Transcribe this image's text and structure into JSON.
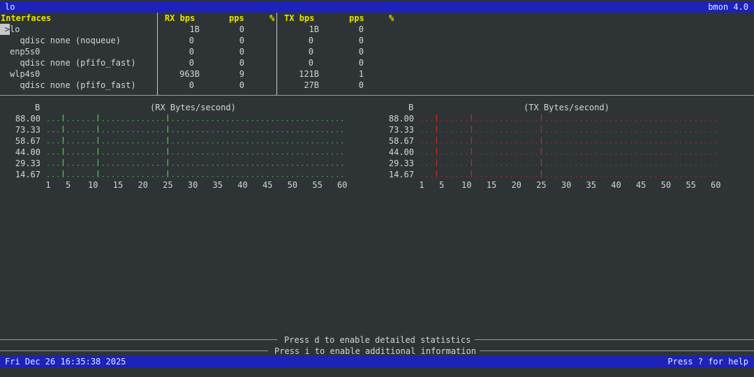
{
  "title_bar": {
    "iface": "lo",
    "app": "bmon 4.0"
  },
  "header": {
    "interfaces": "Interfaces",
    "rx_bps": "RX bps",
    "rx_pps": "pps",
    "rx_pct": "%",
    "tx_bps": "TX bps",
    "tx_pps": "pps",
    "tx_pct": "%"
  },
  "rows": [
    {
      "name": "lo",
      "cursor": ">",
      "rx_bps": "1B",
      "rx_pps": "0",
      "tx_bps": "1B",
      "tx_pps": "0"
    },
    {
      "name": "  qdisc none (noqueue)",
      "rx_bps": "0",
      "rx_pps": "0",
      "tx_bps": "0",
      "tx_pps": "0"
    },
    {
      "name": "enp5s0",
      "rx_bps": "0",
      "rx_pps": "0",
      "tx_bps": "0",
      "tx_pps": "0"
    },
    {
      "name": "  qdisc none (pfifo_fast)",
      "rx_bps": "0",
      "rx_pps": "0",
      "tx_bps": "0",
      "tx_pps": "0"
    },
    {
      "name": "wlp4s0",
      "rx_bps": "963B",
      "rx_pps": "9",
      "tx_bps": "121B",
      "tx_pps": "1"
    },
    {
      "name": "  qdisc none (pfifo_fast)",
      "rx_bps": "0",
      "rx_pps": "0",
      "tx_bps": "27B",
      "tx_pps": "0"
    }
  ],
  "graphs": {
    "rx": {
      "unit": "B",
      "title": "(RX Bytes/second)",
      "color": "#4cc34c"
    },
    "tx": {
      "unit": "B",
      "title": "(TX Bytes/second)",
      "color": "#cc2222"
    },
    "y_labels": [
      "88.00",
      "73.33",
      "58.67",
      "44.00",
      "29.33",
      "14.67"
    ],
    "x_labels": [
      "1",
      "5",
      "10",
      "15",
      "20",
      "25",
      "30",
      "35",
      "40",
      "45",
      "50",
      "55",
      "60"
    ],
    "bar_columns": [
      4,
      11,
      25
    ]
  },
  "footer": {
    "hint1": "Press d to enable detailed statistics",
    "hint2": "Press i to enable additional information"
  },
  "status_bar": {
    "datetime": "Fri Dec 26 16:35:38 2025",
    "help": "Press ? for help"
  }
}
